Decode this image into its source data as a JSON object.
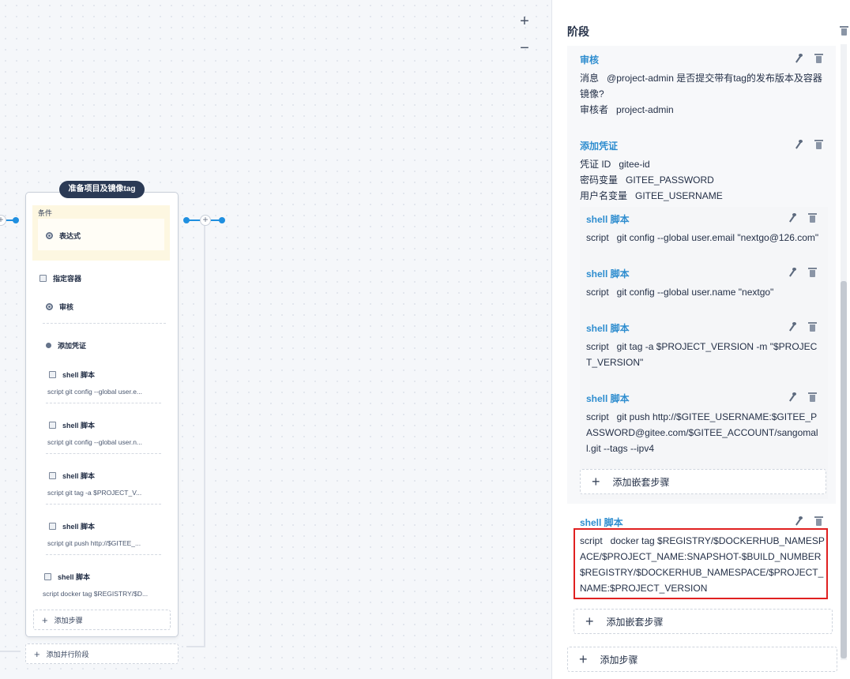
{
  "canvas": {
    "zoom_in": "+",
    "zoom_out": "−",
    "stage": {
      "title": "准备项目及镜像tag",
      "condition_label": "条件",
      "condition_item": "表达式",
      "steps": [
        {
          "title": "指定容器",
          "desc": ""
        },
        {
          "title": "审核",
          "desc": ""
        },
        {
          "title": "添加凭证",
          "desc": ""
        },
        {
          "title": "shell 脚本",
          "desc": "script   git config --global user.e..."
        },
        {
          "title": "shell 脚本",
          "desc": "script   git config --global user.n..."
        },
        {
          "title": "shell 脚本",
          "desc": "script   git tag -a $PROJECT_V..."
        },
        {
          "title": "shell 脚本",
          "desc": "script   git push http://$GITEE_..."
        },
        {
          "title": "shell 脚本",
          "desc": "script   docker tag $REGISTRY/$D..."
        }
      ],
      "add_step": "添加步骤",
      "add_parallel": "添加并行阶段"
    }
  },
  "panel": {
    "title": "阶段",
    "review": {
      "title": "审核",
      "msg_key": "消息",
      "msg_val": "@project-admin 是否提交带有tag的发布版本及容器镜像?",
      "reviewer_key": "审核者",
      "reviewer_val": "project-admin"
    },
    "cred": {
      "title": "添加凭证",
      "id_key": "凭证 ID",
      "id_val": "gitee-id",
      "pwd_key": "密码变量",
      "pwd_val": "GITEE_PASSWORD",
      "user_key": "用户名变量",
      "user_val": "GITEE_USERNAME"
    },
    "nested": [
      {
        "title": "shell 脚本",
        "key": "script",
        "value": "git config --global user.email \"nextgo@126.com\""
      },
      {
        "title": "shell 脚本",
        "key": "script",
        "value": "git config --global user.name \"nextgo\""
      },
      {
        "title": "shell 脚本",
        "key": "script",
        "value": "git tag -a $PROJECT_VERSION -m \"$PROJECT_VERSION\""
      },
      {
        "title": "shell 脚本",
        "key": "script",
        "value": "git push http://$GITEE_USERNAME:$GITEE_PASSWORD@gitee.com/$GITEE_ACCOUNT/sangomall.git --tags --ipv4"
      }
    ],
    "add_nested_inner": "添加嵌套步骤",
    "shell": {
      "title": "shell 脚本",
      "key": "script",
      "value": "docker tag $REGISTRY/$DOCKERHUB_NAMESPACE/$PROJECT_NAME:SNAPSHOT-$BUILD_NUMBER $REGISTRY/$DOCKERHUB_NAMESPACE/$PROJECT_NAME:$PROJECT_VERSION"
    },
    "add_nested_outer": "添加嵌套步骤",
    "add_step": "添加步骤"
  }
}
